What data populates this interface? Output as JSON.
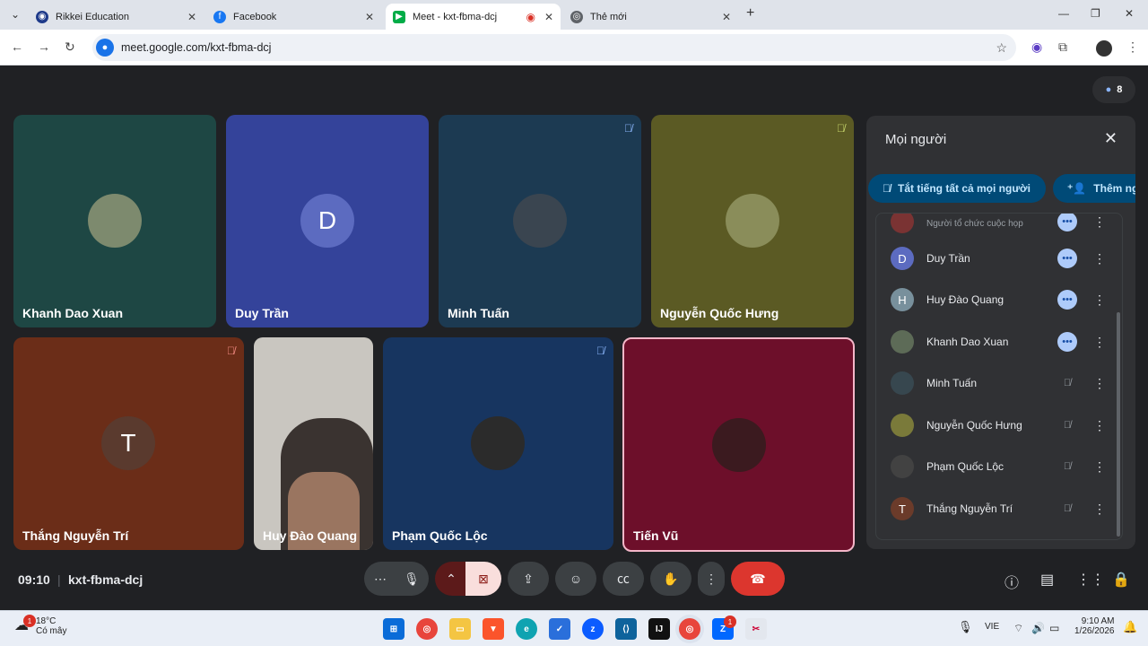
{
  "browser": {
    "tabs": [
      {
        "title": "Rikkei Education",
        "icon": "rikkei-favicon"
      },
      {
        "title": "Facebook",
        "icon": "facebook-favicon"
      },
      {
        "title": "Meet - kxt-fbma-dcj",
        "icon": "meet-favicon"
      },
      {
        "title": "Thẻ mới",
        "icon": "chrome-favicon"
      }
    ],
    "url": "meet.google.com/kxt-fbma-dcj"
  },
  "meet": {
    "participant_count": "8",
    "tiles": [
      {
        "name": "Khanh Dao Xuan",
        "color": "#1e4744",
        "initial": ""
      },
      {
        "name": "Duy Trần",
        "color": "#34439a",
        "initial": "D"
      },
      {
        "name": "Minh Tuấn",
        "color": "#1c3a52",
        "initial": ""
      },
      {
        "name": "Nguyễn Quốc Hưng",
        "color": "#5b5a24",
        "initial": ""
      },
      {
        "name": "Thắng Nguyễn Trí",
        "color": "#6b2d18",
        "initial": "T"
      },
      {
        "name": "Huy Đào Quang",
        "color": "#c9c6c0",
        "initial": ""
      },
      {
        "name": "Phạm Quốc Lộc",
        "color": "#173560",
        "initial": ""
      },
      {
        "name": "Tiến Vũ",
        "color": "#6d0f2a",
        "initial": ""
      }
    ],
    "panel": {
      "title": "Mọi người",
      "mute_all": "Tắt tiếng tất cả mọi người",
      "add_people": "Thêm người",
      "host_label": "Người tổ chức cuộc họp",
      "people": [
        {
          "name": "Duy Trần",
          "initial": "D",
          "color": "#5c6bc0",
          "speaking": true
        },
        {
          "name": "Huy Đào Quang",
          "initial": "H",
          "color": "#78909c",
          "speaking": true
        },
        {
          "name": "Khanh Dao Xuan",
          "initial": "",
          "color": "#5d6b57",
          "speaking": true
        },
        {
          "name": "Minh Tuấn",
          "initial": "",
          "color": "#37474f",
          "speaking": false
        },
        {
          "name": "Nguyễn Quốc Hưng",
          "initial": "",
          "color": "#7a7a3a",
          "speaking": false
        },
        {
          "name": "Phạm Quốc Lộc",
          "initial": "",
          "color": "#424242",
          "speaking": false
        },
        {
          "name": "Thắng Nguyễn Trí",
          "initial": "T",
          "color": "#6b3b2a",
          "speaking": false
        }
      ]
    },
    "time": "09:10",
    "meeting_code": "kxt-fbma-dcj"
  },
  "taskbar": {
    "temperature": "18°C",
    "weather": "Có mây",
    "lang": "VIE",
    "clock_time": "9:10 AM",
    "clock_date": "1/26/2026",
    "weather_badge": "1",
    "zalo_badge": "1"
  }
}
